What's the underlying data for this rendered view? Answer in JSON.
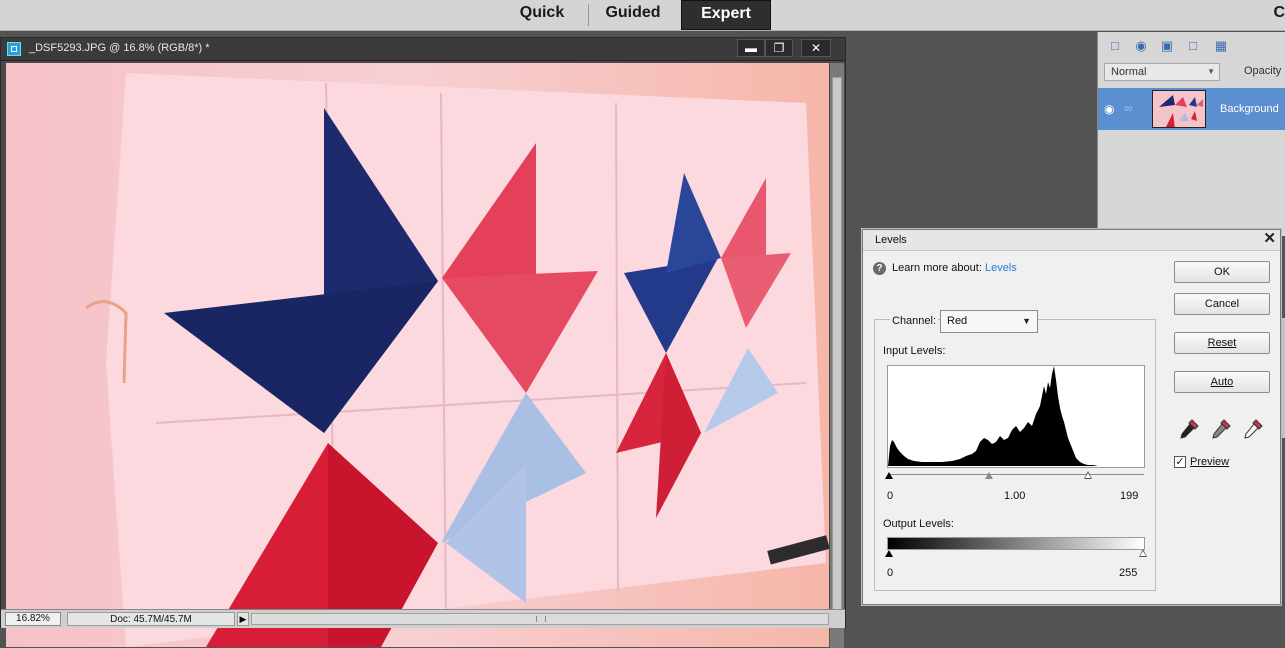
{
  "top_bar": {
    "tabs": [
      "Quick",
      "Guided",
      "Expert"
    ],
    "active_tab": "Expert",
    "cut_label": "C"
  },
  "document": {
    "title": "_DSF5293.JPG @ 16.8% (RGB/8*) *",
    "zoom": "16.82%",
    "doc_info": "Doc: 45.7M/45.7M",
    "window_buttons": [
      "minimize",
      "restore",
      "close"
    ]
  },
  "layers_panel": {
    "blend_mode": "Normal",
    "opacity_label": "Opacity",
    "layer_name": "Background",
    "icons": [
      "new-layer-icon",
      "fill-adjustment-icon",
      "mask-icon",
      "lock-icon",
      "lock-pixels-icon"
    ]
  },
  "levels_dialog": {
    "title": "Levels",
    "learn_prefix": "Learn more about:",
    "learn_link": "Levels",
    "channel_label": "Channel:",
    "channel_value": "Red",
    "input_levels_label": "Input Levels:",
    "input_black": "0",
    "input_gamma": "1.00",
    "input_white": "199",
    "output_levels_label": "Output Levels:",
    "output_black": "0",
    "output_white": "255",
    "buttons": {
      "ok": "OK",
      "cancel": "Cancel",
      "reset": "Reset",
      "auto": "Auto"
    },
    "preview_label": "Preview",
    "preview_checked": true,
    "eyedroppers": [
      "black-point-eyedropper-icon",
      "gray-point-eyedropper-icon",
      "white-point-eyedropper-icon"
    ]
  },
  "colors": {
    "accent_link": "#2a7fd4",
    "layer_selected": "#5b8fd0",
    "workspace": "#535353"
  }
}
